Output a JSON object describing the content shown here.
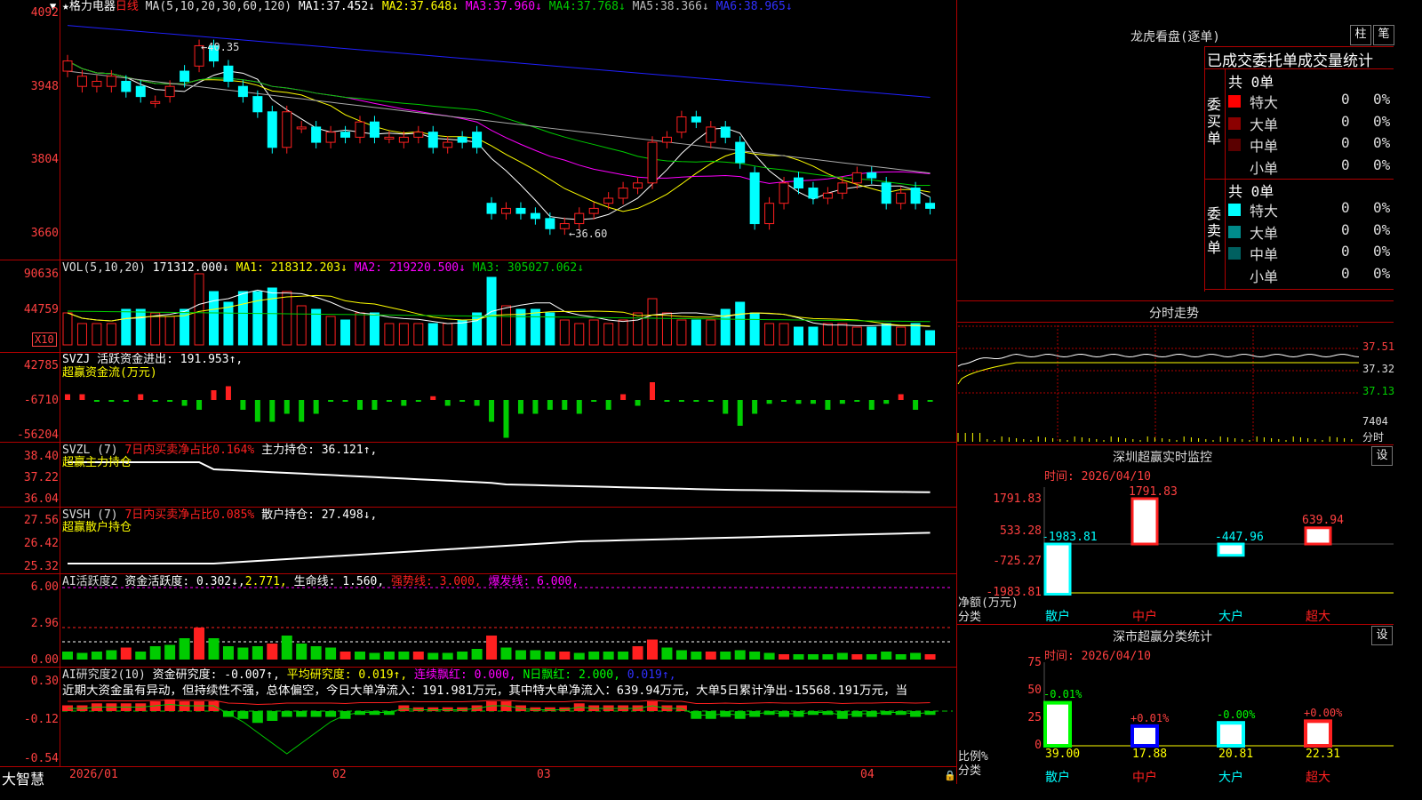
{
  "colors": {
    "up": "#ff2020",
    "down": "#00ffff",
    "bg": "#000000",
    "grid": "#b00000",
    "ma1": "#ffffff",
    "ma2": "#ffff00",
    "ma3": "#ff00ff",
    "ma4": "#00cc00",
    "ma5": "#aaaaaa",
    "ma6": "#2020ff"
  },
  "main": {
    "star_name": "★格力电器",
    "period": "日线",
    "ma_params": "MA(5,10,20,30,60,120)",
    "ma": [
      {
        "label": "MA1:",
        "value": "37.452↓"
      },
      {
        "label": "MA2:",
        "value": "37.648↓"
      },
      {
        "label": "MA3:",
        "value": "37.960↓"
      },
      {
        "label": "MA4:",
        "value": "37.768↓"
      },
      {
        "label": "MA5:",
        "value": "38.366↓"
      },
      {
        "label": "MA6:",
        "value": "38.965↓"
      }
    ],
    "y_ticks": [
      "4092",
      "3948",
      "3804",
      "3660"
    ],
    "high_label": "←40.35",
    "low_label": "←36.60"
  },
  "vol": {
    "params": "VOL(5,10,20)",
    "value": "171312.000↓",
    "ma1": "MA1: 218312.203↓",
    "ma2": "MA2: 219220.500↓",
    "ma3": "MA3: 305027.062↓",
    "y_ticks": [
      "90636",
      "44759"
    ],
    "unit": "X10"
  },
  "svzj": {
    "label": "SVZJ  活跃资金进出: 191.953↑,",
    "sub": "超赢资金流(万元)",
    "y_ticks": [
      "42785",
      "-6710",
      "-56204"
    ]
  },
  "svzl": {
    "name": "SVZL (7)",
    "red_text": "7日内买卖净占比0.164%",
    "white_text": "主力持仓: 36.121↑,",
    "sub": "超赢主力持仓",
    "y_ticks": [
      "38.40",
      "37.22",
      "36.04"
    ]
  },
  "svsh": {
    "name": "SVSH (7)",
    "red_text": "7日内买卖净占比0.085%",
    "white_text": "散户持仓: 27.498↓,",
    "sub": "超赢散户持仓",
    "y_ticks": [
      "27.56",
      "26.42",
      "25.32"
    ]
  },
  "ai1": {
    "name": "AI活跃度2",
    "text1": "资金活跃度: 0.302↓,",
    "text2": "2.771,",
    "text3": "生命线: 1.560,",
    "text4": "强势线: 3.000,",
    "text5": "爆发线: 6.000,",
    "y_ticks": [
      "6.00",
      "2.96",
      "0.00"
    ]
  },
  "ai2": {
    "name": "AI研究度2(10)",
    "text1": "资金研究度: -0.007↑,",
    "text2": "平均研究度: 0.019↑,",
    "text3": "连续飘红: 0.000,",
    "text4": "N日飘红: 2.000,",
    "text5": "0.019↑,",
    "comment": "近期大资金虽有异动，但持续性不强，总体偏空，今日大单净流入：191.981万元，其中特大单净流入：639.94万元，大单5日累计净出-15568.191万元，当",
    "y_ticks": [
      "0.30",
      "-0.12",
      "-0.54"
    ]
  },
  "xaxis": {
    "logo": "大智慧",
    "dates": [
      "2026/01",
      "02",
      "03",
      "04"
    ]
  },
  "right": {
    "lhb_title": "龙虎看盘(逐单)",
    "btn_bar": "柱",
    "btn_pen": "笔",
    "table_header": "已成交委托单成交量统计",
    "buy": {
      "side": "委买单",
      "count": "共 0单",
      "rows": [
        {
          "label": "特大",
          "num": "0",
          "pct": "0%",
          "color": "#ff0000"
        },
        {
          "label": "大单",
          "num": "0",
          "pct": "0%",
          "color": "#8b0000"
        },
        {
          "label": "中单",
          "num": "0",
          "pct": "0%",
          "color": "#5a0000"
        },
        {
          "label": "小单",
          "num": "0",
          "pct": "0%",
          "color": "#000000"
        }
      ]
    },
    "sell": {
      "side": "委卖单",
      "count": "共 0单",
      "rows": [
        {
          "label": "特大",
          "num": "0",
          "pct": "0%",
          "color": "#00ffff"
        },
        {
          "label": "大单",
          "num": "0",
          "pct": "0%",
          "color": "#008b8b"
        },
        {
          "label": "中单",
          "num": "0",
          "pct": "0%",
          "color": "#006060"
        },
        {
          "label": "小单",
          "num": "0",
          "pct": "0%",
          "color": "#000000"
        }
      ]
    },
    "fenshi": {
      "title": "分时走势",
      "prices": [
        "37.51",
        "37.32",
        "37.13"
      ],
      "vol": "7404",
      "unit": "分时"
    },
    "monitor": {
      "title": "深圳超赢实时监控",
      "btn": "设",
      "time": "时间: 2026/04/10",
      "y_ticks": [
        "1791.83",
        "533.28",
        "-725.27",
        "-1983.81"
      ],
      "ylabel1": "净额(万元)",
      "ylabel2": "分类",
      "categories": [
        "散户",
        "中户",
        "大户",
        "超大"
      ],
      "values": [
        -1983.81,
        1791.83,
        -447.96,
        639.94
      ],
      "labels": [
        "-1983.81",
        "1791.83",
        "-447.96",
        "639.94"
      ]
    },
    "classify": {
      "title": "深市超赢分类统计",
      "btn": "设",
      "time": "时间: 2026/04/10",
      "y_ticks": [
        "75",
        "50",
        "25",
        "0"
      ],
      "ylabel1": "比例%",
      "ylabel2": "分类",
      "categories": [
        "散户",
        "中户",
        "大户",
        "超大"
      ],
      "values": [
        39.0,
        17.88,
        20.81,
        22.31
      ],
      "value_labels": [
        "39.00",
        "17.88",
        "20.81",
        "22.31"
      ],
      "changes": [
        "-0.01%",
        "+0.01%",
        "-0.00%",
        "+0.00%"
      ]
    }
  }
}
